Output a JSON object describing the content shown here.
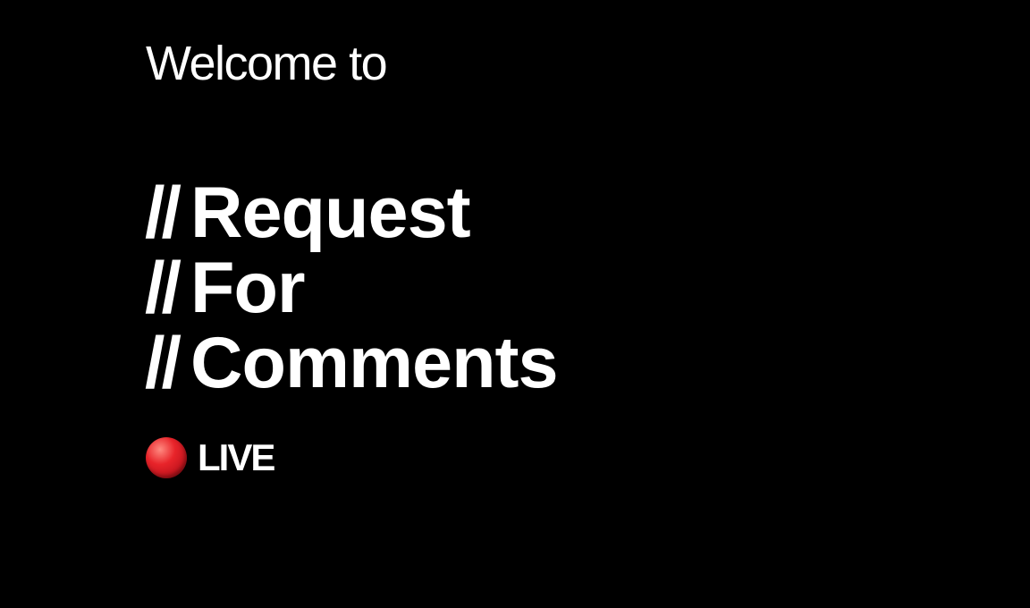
{
  "welcome": "Welcome to",
  "title": {
    "lines": [
      {
        "prefix": "//",
        "word": "Request"
      },
      {
        "prefix": "//",
        "word": "For"
      },
      {
        "prefix": "//",
        "word": "Comments"
      }
    ]
  },
  "live": {
    "label": "LIVE",
    "icon": "red-circle-icon",
    "color": "#e8242a"
  },
  "colors": {
    "background": "#000000",
    "text": "#ffffff"
  }
}
